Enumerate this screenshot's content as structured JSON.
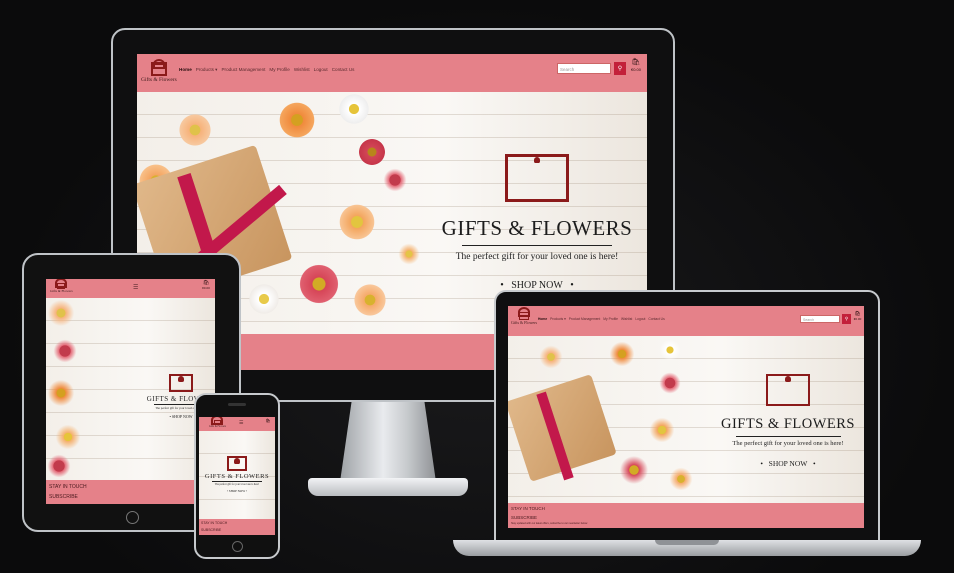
{
  "site": {
    "logo_text": "Gifts & Flowers",
    "nav_links": [
      "Home",
      "Products ▾",
      "Product Management",
      "My Profile",
      "Wishlist",
      "Logout",
      "Contact Us"
    ],
    "search_placeholder": "Search",
    "search_icon": "search-icon",
    "bag_icon": "shopping-bag-icon",
    "bag_total": "€0.00",
    "menu_icon": "hamburger-menu-icon",
    "brand_title": "GIFTS & FLOWERS",
    "tagline": "The perfect gift for your loved one is here!",
    "shop_now": "SHOP NOW",
    "footer_stay": "STAY IN TOUCH",
    "footer_subscribe": "SUBSCRIBE",
    "footer_note": "Stay updated with our latest offers, subscribe to our newsletter below"
  },
  "colors": {
    "nav_pink": "#e58189",
    "brand_red": "#8b1a1a",
    "button_red": "#c3203a",
    "ribbon": "#c2184b"
  }
}
